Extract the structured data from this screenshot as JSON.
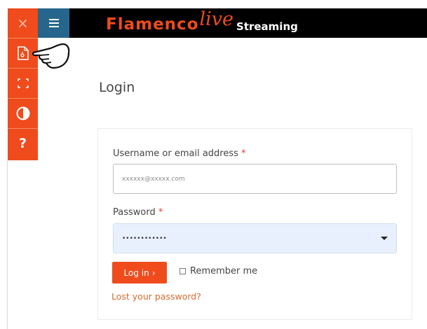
{
  "brand": {
    "name": "Flamenco",
    "script": "live",
    "tagline": "Streaming"
  },
  "toolbar": {
    "close_glyph": "×",
    "menu_glyph": "≡",
    "help_glyph": "?"
  },
  "page": {
    "title": "Login"
  },
  "form": {
    "username_label": "Username or email address",
    "required_mark": "*",
    "username_value": "xxxxxx@xxxxx.com",
    "password_label": "Password",
    "password_value": "••••••••••••",
    "login_label": "Log in",
    "login_arrow": "›",
    "remember_label": "Remember me",
    "lost_password": "Lost your password?"
  },
  "colors": {
    "accent": "#ef4b1c",
    "menu_blue": "#26668c",
    "banner": "#000000",
    "link": "#d9692e"
  }
}
